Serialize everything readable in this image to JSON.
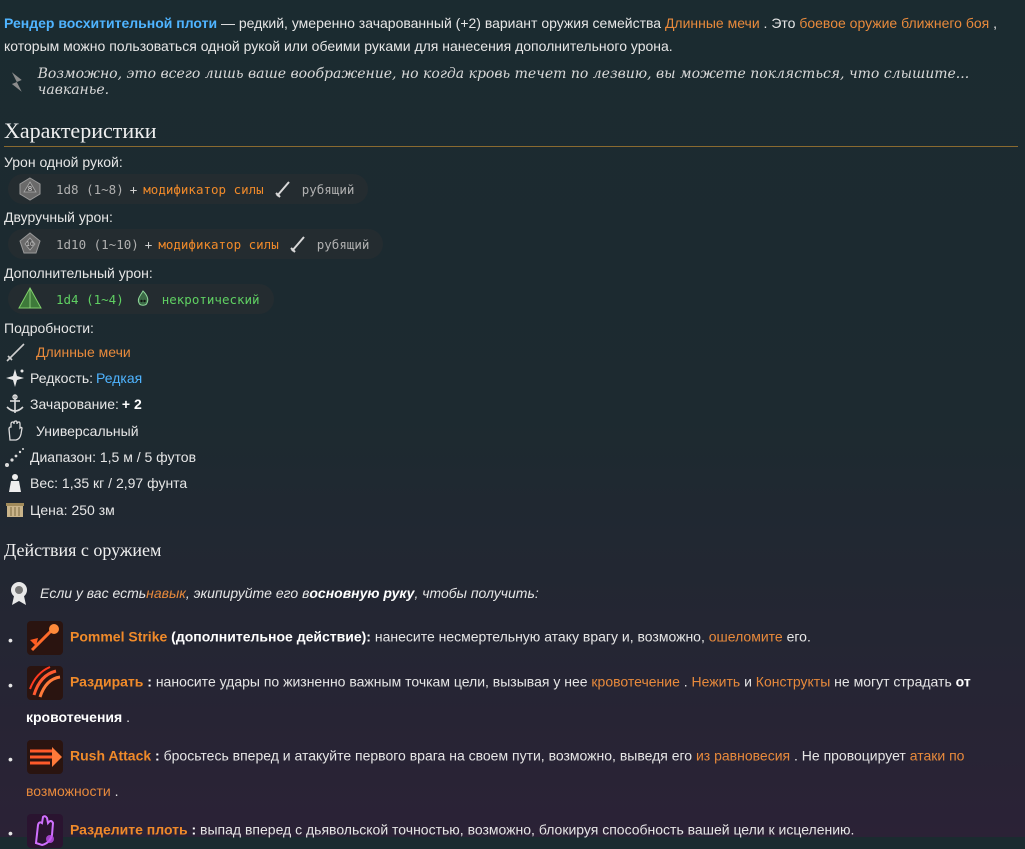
{
  "intro": {
    "name": "Рендер восхитительной плоти",
    "t1": " — редкий, умеренно зачарованный (+2) вариант оружия семейства ",
    "link_family": "Длинные мечи",
    "t2": " . Это ",
    "link_type": "боевое оружие ближнего боя",
    "t3": " , которым можно пользоваться одной рукой или обеими руками для нанесения дополнительного урона."
  },
  "quote": "Возможно, это всего лишь ваше воображение, но когда кровь течет по лезвию, вы можете поклясться, что слышите... чавканье.",
  "characteristics": {
    "heading": "Характеристики",
    "one_hand": {
      "label": "Урон одной рукой:",
      "dice": "1d8 (1~8)",
      "plus": "+",
      "modifier": "модификатор силы",
      "type": "рубящий",
      "die_face": "8"
    },
    "two_hand": {
      "label": "Двуручный урон:",
      "dice": "1d10 (1~10)",
      "plus": "+",
      "modifier": "модификатор силы",
      "type": "рубящий",
      "die_face": "10"
    },
    "extra": {
      "label": "Дополнительный урон:",
      "dice": "1d4 (1~4)",
      "type": "некротический"
    },
    "details_label": "Подробности:",
    "details": {
      "family": "Длинные мечи",
      "rarity_label": "Редкость: ",
      "rarity_value": "Редкая",
      "enchant_label": "Зачарование: ",
      "enchant_value": "+ 2",
      "versatile": "Универсальный",
      "range": "Диапазон: 1,5 м / 5 футов",
      "weight": "Вес: 1,35 кг / 2,97 фунта",
      "price": "Цена: 250 зм"
    }
  },
  "actions": {
    "heading": "Действия с оружием",
    "tip": {
      "t1": "Если у вас есть ",
      "link": "навык",
      "t2": " , экипируйте его в ",
      "bold": "основную руку",
      "t3": " , чтобы получить:"
    },
    "items": [
      {
        "name": "Pommel Strike",
        "extra": " (дополнительное действие):",
        "t1": " нанесите несмертельную атаку врагу и, возможно, ",
        "l1": "ошеломите",
        "t2": " его."
      },
      {
        "name": "Раздирать",
        "extra": " :",
        "t1": " наносите удары по жизненно важным точкам цели, вызывая у нее ",
        "l1": "кровотечение",
        "t2": " . ",
        "l2": "Нежить",
        "t3": " и ",
        "l3": "Конструкты",
        "t4": " не могут страдать ",
        "b1": "от кровотечения",
        "t5": " ."
      },
      {
        "name": "Rush Attack",
        "extra": " :",
        "t1": " бросьтесь вперед и атакуйте первого врага на своем пути, возможно, выведя его ",
        "l1": "из равновесия",
        "t2": " . Не провоцирует ",
        "l2": "атаки по возможности",
        "t3": " ."
      },
      {
        "name": "Разделите плоть",
        "extra": " :",
        "t1": " выпад вперед с дьявольской точностью, возможно, блокируя способность вашей цели к исцелению."
      }
    ]
  },
  "colors": {
    "link": "#e88a3c",
    "rarity": "#4fb4ff",
    "necrotic": "#5fcf62",
    "modifier": "#f08a2a"
  },
  "icons": [
    "d8-die-icon",
    "d10-die-icon",
    "d4-die-icon",
    "slashing-icon",
    "necrotic-icon",
    "longsword-icon",
    "rarity-sparkle-icon",
    "enchant-icon",
    "versatile-hand-icon",
    "range-icon",
    "weight-icon",
    "price-scroll-icon",
    "proficiency-icon",
    "pommel-strike-icon",
    "rend-icon",
    "rush-attack-icon",
    "flesh-icon"
  ]
}
